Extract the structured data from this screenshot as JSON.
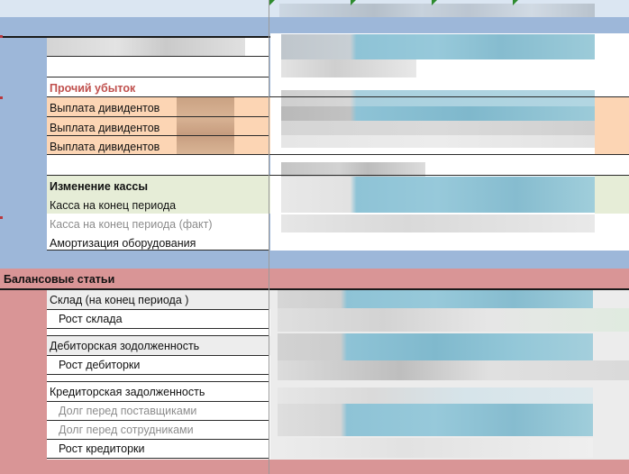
{
  "colors": {
    "section_blue": "#9db7d9",
    "section_red": "#d99596",
    "header_strip": "#dbe6f2",
    "orange_highlight": "#fcd5b4",
    "green_highlight": "#e6edd7",
    "light_gray": "#ededed",
    "accent_red_text": "#c0504d",
    "muted_text": "#8c8c8c",
    "blurred_blue": "#8ec3d6",
    "blurred_gray": "#c7c7c7"
  },
  "cashflow": {
    "other_loss": "Прочий убыток",
    "dividend_1": "Выплата дивидентов",
    "dividend_2": "Выплата дивидентов",
    "dividend_3": "Выплата дивидентов",
    "cash_change": "Изменение кассы",
    "cash_end": "Касса на конец периода",
    "cash_end_fact": "Касса на конец периода (факт)",
    "amortization": "Амортизация оборудования"
  },
  "balance": {
    "section_title": "Балансовые статьи",
    "inventory_end": "Склад (на конец периода )",
    "inventory_growth": "Рост склада",
    "receivables": "Дебиторская зодолженность",
    "receivables_growth": "Рост дебиторки",
    "payables": "Кредиторская задолженность",
    "debt_suppliers": "Долг перед поставщиками",
    "debt_employees": "Долг перед сотрудниками",
    "payables_growth": "Рост кредиторки"
  }
}
